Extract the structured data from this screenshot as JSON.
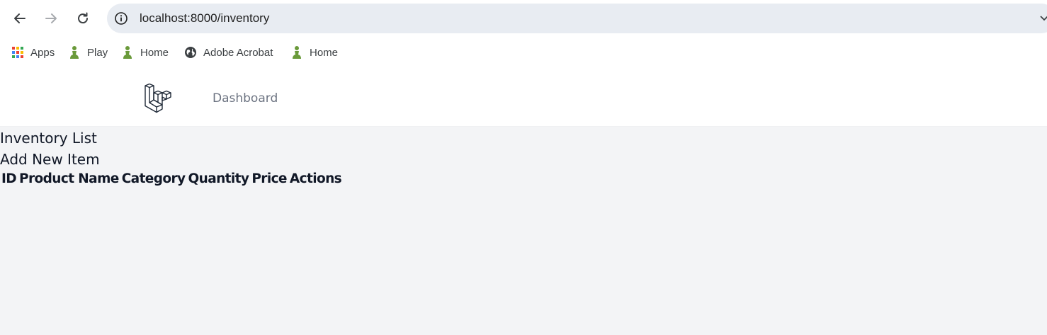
{
  "browser": {
    "url": "localhost:8000/inventory",
    "bookmarks": [
      {
        "label": "Apps",
        "icon": "apps-grid-icon"
      },
      {
        "label": "Play",
        "icon": "chess-pawn-icon"
      },
      {
        "label": "Home",
        "icon": "chess-pawn-icon"
      },
      {
        "label": "Adobe Acrobat",
        "icon": "globe-icon"
      },
      {
        "label": "Home",
        "icon": "chess-pawn-icon"
      }
    ]
  },
  "header": {
    "logo": "laravel-logo",
    "nav": {
      "dashboard_label": "Dashboard"
    }
  },
  "main": {
    "title": "Inventory List",
    "add_link_label": "Add New Item",
    "table": {
      "columns": [
        "ID",
        "Product Name",
        "Category",
        "Quantity",
        "Price",
        "Actions"
      ],
      "rows": []
    }
  },
  "colors": {
    "page_background": "#f3f4f6",
    "header_background": "#ffffff",
    "omnibox_background": "#e8ecf2",
    "nav_link": "#6b7280",
    "pawn_green": "#6a9a3a"
  }
}
